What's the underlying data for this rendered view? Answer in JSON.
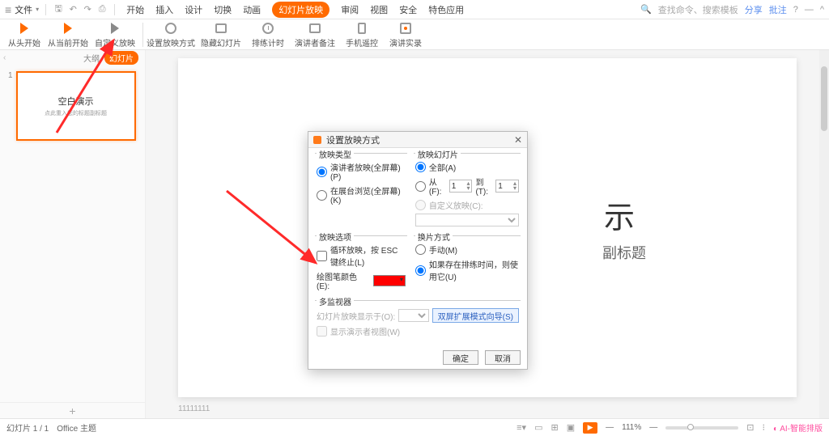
{
  "titlebar": {
    "file_label": "文件",
    "search_placeholder": "查找命令、搜索模板",
    "share": "分享",
    "comment": "批注"
  },
  "menu": {
    "start": "开始",
    "insert": "插入",
    "design": "设计",
    "transition": "切换",
    "animation": "动画",
    "slideshow": "幻灯片放映",
    "review": "审阅",
    "view": "视图",
    "security": "安全",
    "special": "特色应用"
  },
  "toolbar": {
    "from_begin": "从头开始",
    "from_current": "从当前开始",
    "custom_show": "自定义放映",
    "setup_show": "设置放映方式",
    "hide_slide": "隐藏幻灯片",
    "rehearse": "排练计时",
    "presenter_notes": "演讲者备注",
    "phone_remote": "手机遥控",
    "record": "演讲实录"
  },
  "sidebar": {
    "tab_outline": "大纲",
    "tab_slides": "幻灯片",
    "thumb_title": "空白演示",
    "thumb_sub": "点此重入您的标题副标题",
    "add": "+"
  },
  "slide": {
    "title": "示",
    "subtitle": "副标题",
    "notes": "11111111"
  },
  "dialog": {
    "title": "设置放映方式",
    "grp_type": "放映类型",
    "type_presenter": "演讲者放映(全屏幕)(P)",
    "type_kiosk": "在展台浏览(全屏幕)(K)",
    "grp_slides": "放映幻灯片",
    "slides_all": "全部(A)",
    "slides_from": "从(F):",
    "slides_to": "到(T):",
    "from_val": "1",
    "to_val": "1",
    "slides_custom": "自定义放映(C):",
    "grp_options": "放映选项",
    "opt_loop": "循环放映，按 ESC 键终止(L)",
    "opt_pen": "绘图笔颜色(E):",
    "grp_advance": "换片方式",
    "adv_manual": "手动(M)",
    "adv_timing": "如果存在排练时间，则使用它(U)",
    "grp_monitor": "多监视器",
    "mon_display": "幻灯片放映显示于(O):",
    "mon_presenter": "显示演示者视图(W)",
    "btn_ext": "双屏扩展模式向导(S)",
    "btn_ok": "确定",
    "btn_cancel": "取消"
  },
  "status": {
    "slide_info": "幻灯片 1 / 1",
    "theme": "Office 主题",
    "zoom": "111%",
    "ai": "AI-智能排版"
  }
}
